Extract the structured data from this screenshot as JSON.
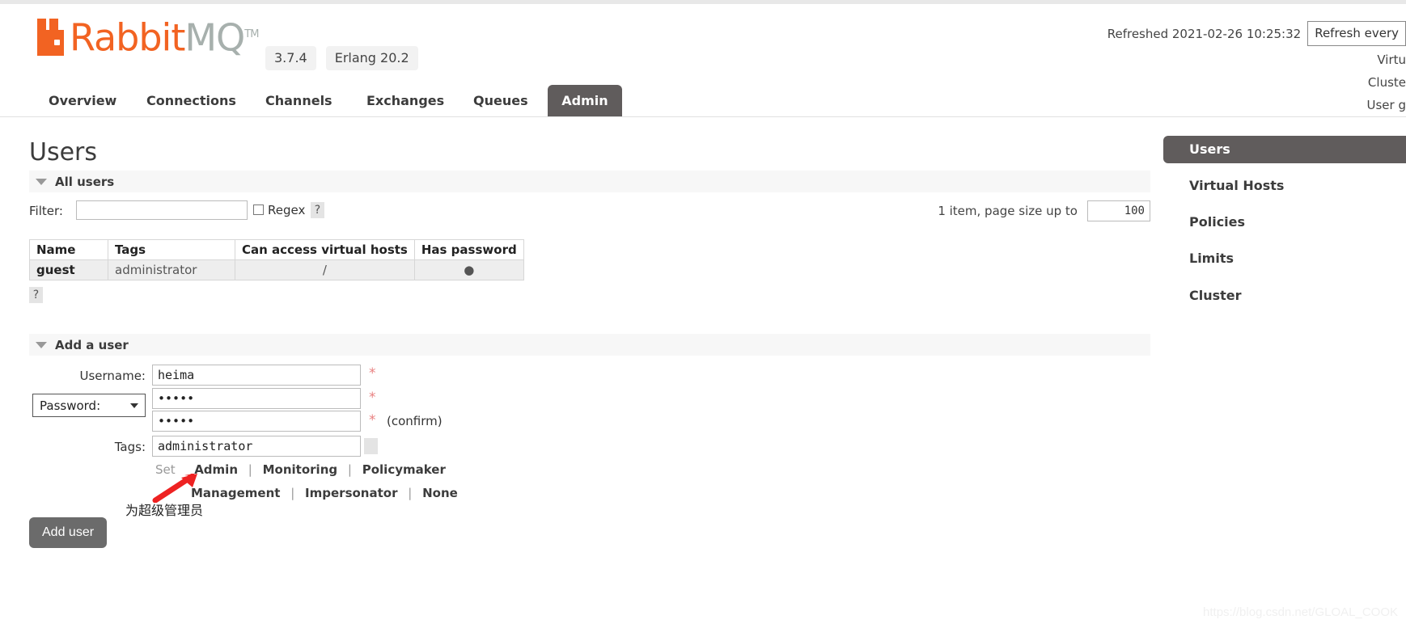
{
  "app": {
    "brand_rabbit": "Rabbit",
    "brand_mq": "MQ",
    "brand_tm": "TM",
    "accent_color": "#f26322",
    "muted_color": "#a7b0ad"
  },
  "header": {
    "version": "3.7.4",
    "erlang_version": "Erlang 20.2",
    "refreshed_label": "Refreshed 2021-02-26 10:25:32",
    "refresh_select_value": "Refresh every",
    "meta_lines": [
      "Virtu",
      "Cluste",
      "User g"
    ]
  },
  "nav": {
    "tabs": [
      {
        "label": "Overview",
        "active": false
      },
      {
        "label": "Connections",
        "active": false
      },
      {
        "label": "Channels",
        "active": false
      },
      {
        "label": "Exchanges",
        "active": false
      },
      {
        "label": "Queues",
        "active": false
      },
      {
        "label": "Admin",
        "active": true
      }
    ]
  },
  "page": {
    "title": "Users"
  },
  "all_users_section": {
    "heading": "All users",
    "filter_label": "Filter:",
    "filter_value": "",
    "regex_label": "Regex",
    "help_glyph": "?",
    "page_size_text": "1 item, page size up to",
    "page_size_value": "100",
    "table": {
      "columns": [
        "Name",
        "Tags",
        "Can access virtual hosts",
        "Has password"
      ],
      "rows": [
        {
          "name": "guest",
          "tags": "administrator",
          "vhosts": "/",
          "has_password": "●"
        }
      ]
    }
  },
  "add_user_section": {
    "heading": "Add a user",
    "username_label": "Username:",
    "username_value": "heima",
    "password_select_label": "Password:",
    "password_value": "•••••",
    "password_confirm_value": "•••••",
    "confirm_note": "(confirm)",
    "tags_label": "Tags:",
    "tags_value": "administrator",
    "required_star": "*",
    "set_word": "Set",
    "tag_links_row1": [
      "Admin",
      "Monitoring",
      "Policymaker"
    ],
    "tag_links_row2": [
      "Management",
      "Impersonator",
      "None"
    ],
    "separator": "|",
    "submit_label": "Add user",
    "annotation_text": "为超级管理员"
  },
  "sidebar": {
    "items": [
      {
        "label": "Users",
        "active": true
      },
      {
        "label": "Virtual Hosts",
        "active": false
      },
      {
        "label": "Policies",
        "active": false
      },
      {
        "label": "Limits",
        "active": false
      },
      {
        "label": "Cluster",
        "active": false
      }
    ]
  },
  "watermark": {
    "text": "https://blog.csdn.net/GLOAL_COOK"
  }
}
